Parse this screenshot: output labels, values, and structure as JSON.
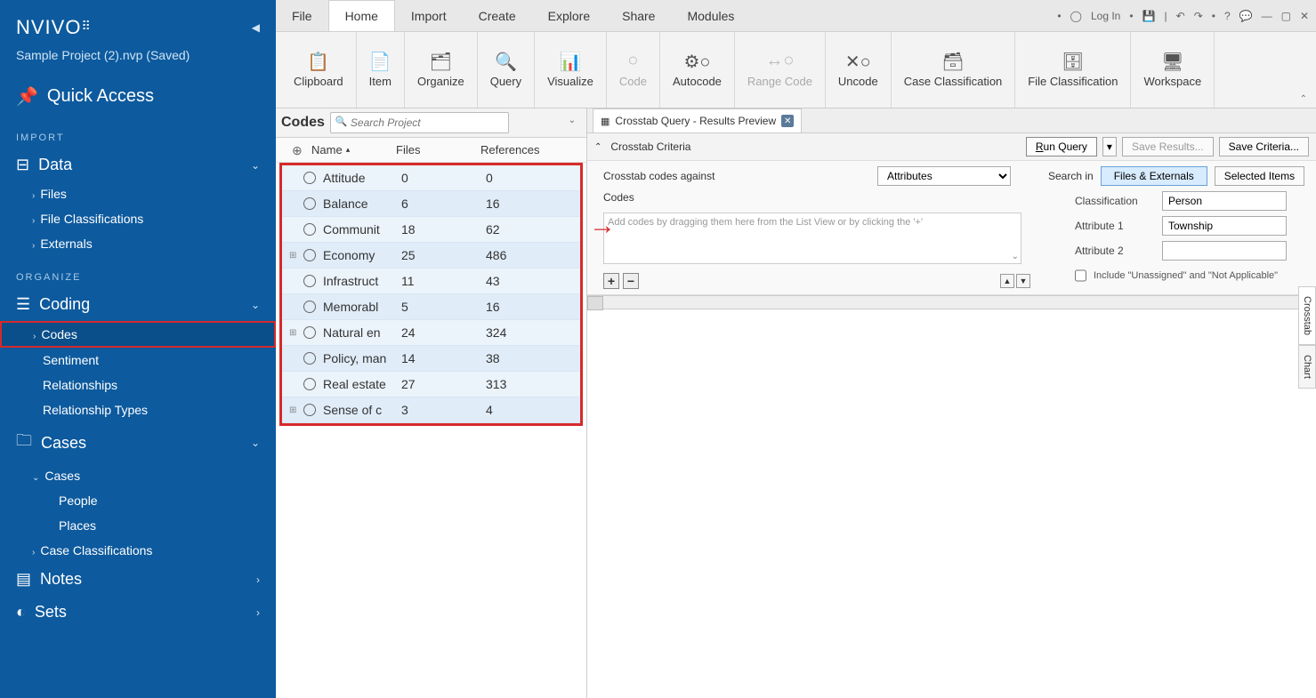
{
  "app": {
    "logo": "NVIVO",
    "project": "Sample Project (2).nvp (Saved)"
  },
  "quick_access": "Quick Access",
  "sections": {
    "import": "IMPORT",
    "organize": "ORGANIZE"
  },
  "nav": {
    "data": "Data",
    "files": "Files",
    "file_class": "File Classifications",
    "externals": "Externals",
    "coding": "Coding",
    "codes": "Codes",
    "sentiment": "Sentiment",
    "relationships": "Relationships",
    "rel_types": "Relationship Types",
    "cases": "Cases",
    "cases_sub": "Cases",
    "people": "People",
    "places": "Places",
    "case_class": "Case Classifications",
    "notes": "Notes",
    "sets": "Sets"
  },
  "menu": {
    "file": "File",
    "home": "Home",
    "import": "Import",
    "create": "Create",
    "explore": "Explore",
    "share": "Share",
    "modules": "Modules",
    "login": "Log In"
  },
  "ribbon": {
    "clipboard": "Clipboard",
    "item": "Item",
    "organize": "Organize",
    "query": "Query",
    "visualize": "Visualize",
    "code": "Code",
    "autocode": "Autocode",
    "range": "Range Code",
    "uncode": "Uncode",
    "casec": "Case Classification",
    "filec": "File Classification",
    "workspace": "Workspace"
  },
  "list": {
    "title": "Codes",
    "search_ph": "Search Project",
    "cols": {
      "name": "Name",
      "files": "Files",
      "refs": "References"
    },
    "rows": [
      {
        "exp": "",
        "name": "Attitude",
        "files": "0",
        "refs": "0"
      },
      {
        "exp": "",
        "name": "Balance",
        "files": "6",
        "refs": "16"
      },
      {
        "exp": "",
        "name": "Communit",
        "files": "18",
        "refs": "62"
      },
      {
        "exp": "+",
        "name": "Economy",
        "files": "25",
        "refs": "486"
      },
      {
        "exp": "",
        "name": "Infrastruct",
        "files": "11",
        "refs": "43"
      },
      {
        "exp": "",
        "name": "Memorabl",
        "files": "5",
        "refs": "16"
      },
      {
        "exp": "+",
        "name": "Natural en",
        "files": "24",
        "refs": "324"
      },
      {
        "exp": "",
        "name": "Policy, man",
        "files": "14",
        "refs": "38"
      },
      {
        "exp": "",
        "name": "Real estate",
        "files": "27",
        "refs": "313"
      },
      {
        "exp": "+",
        "name": "Sense of c",
        "files": "3",
        "refs": "4"
      }
    ]
  },
  "detail": {
    "tab": "Crosstab Query - Results Preview",
    "criteria": "Crosstab Criteria",
    "run": "Run Query",
    "save_res": "Save Results...",
    "save_crit": "Save Criteria...",
    "against": "Crosstab codes against",
    "against_val": "Attributes",
    "searchin": "Search in",
    "files_ext": "Files & Externals",
    "sel_items": "Selected Items",
    "codes_lbl": "Codes",
    "dz": "Add codes by dragging them here from the List View or by clicking the '+'",
    "classif": "Classification",
    "classif_val": "Person",
    "attr1": "Attribute 1",
    "attr1_val": "Township",
    "attr2": "Attribute 2",
    "incl": "Include \"Unassigned\" and \"Not Applicable\"",
    "sidetab1": "Crosstab",
    "sidetab2": "Chart"
  }
}
